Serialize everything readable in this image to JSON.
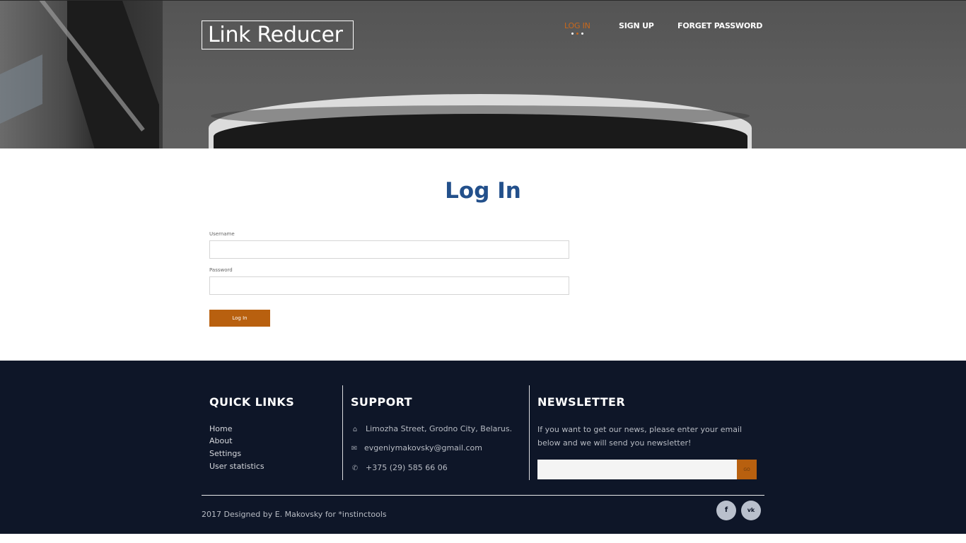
{
  "header": {
    "logo": "Link Reducer",
    "nav": [
      {
        "label": "LOG IN",
        "active": true
      },
      {
        "label": "SIGN UP",
        "active": false
      },
      {
        "label": "FORGET PASSWORD",
        "active": false
      }
    ]
  },
  "main": {
    "title": "Log In",
    "username_label": "Username",
    "username_value": "",
    "password_label": "Password",
    "password_value": "",
    "submit_label": "Log In"
  },
  "footer": {
    "quick_links": {
      "heading": "QUICK LINKS",
      "items": [
        "Home",
        "About",
        "Settings",
        "User statistics"
      ]
    },
    "support": {
      "heading": "SUPPORT",
      "address": "Limozha Street, Grodno City, Belarus.",
      "email": "evgeniymakovsky@gmail.com",
      "phone": "+375 (29) 585 66 06",
      "icons": [
        "home-icon",
        "envelope-icon",
        "phone-icon"
      ]
    },
    "newsletter": {
      "heading": "NEWSLETTER",
      "text": "If you want to get our news, please enter your email below and we will send you newsletter!",
      "email_value": "",
      "button_label": "GO"
    },
    "copyright": "2017 Designed by E. Makovsky for *instinctools",
    "social": [
      {
        "icon": "facebook-icon",
        "glyph": "f"
      },
      {
        "icon": "vk-icon",
        "glyph": "vk"
      }
    ]
  },
  "colors": {
    "accent": "#b8600f",
    "title_blue": "#23508b",
    "footer_bg": "#0e1628"
  }
}
